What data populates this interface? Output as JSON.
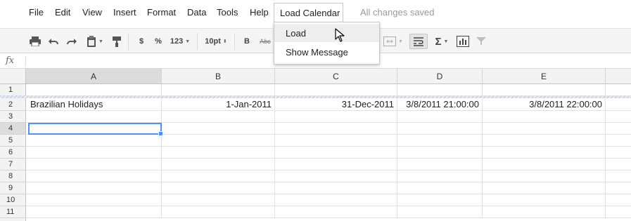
{
  "menubar": {
    "items": [
      "File",
      "Edit",
      "View",
      "Insert",
      "Format",
      "Data",
      "Tools",
      "Help"
    ],
    "open_menu": "Load Calendar",
    "status": "All changes saved"
  },
  "toolbar": {
    "currency": "$",
    "percent": "%",
    "number_format": "123",
    "font_size": "10pt",
    "bold": "B",
    "strikethrough": "Abc",
    "icons": [
      "print-icon",
      "undo-icon",
      "redo-icon",
      "paint-format-icon",
      "clipboard-icon",
      "merge-cells-icon",
      "wrap-text-icon",
      "sigma-icon",
      "chart-icon",
      "filter-icon"
    ]
  },
  "formula_bar": {
    "label": "fx",
    "value": ""
  },
  "grid": {
    "columns": [
      "A",
      "B",
      "C",
      "D",
      "E"
    ],
    "selected_column": "A",
    "rows": [
      "1",
      "2",
      "3",
      "4",
      "5",
      "6",
      "7",
      "8",
      "9",
      "10",
      "11"
    ],
    "selected_row": "4",
    "cells": {
      "A2": "Brazilian Holidays",
      "B2": "1-Jan-2011",
      "C2": "31-Dec-2011",
      "D2": "3/8/2011 21:00:00",
      "E2": "3/8/2011 22:00:00"
    }
  },
  "dropdown": {
    "items": [
      "Load",
      "Show Message"
    ],
    "hovered": "Load"
  },
  "colors": {
    "selection": "#4d90fe",
    "header_bg": "#f3f3f3",
    "header_selected_bg": "#dcdcdc",
    "status_text": "#9a9a9a"
  }
}
